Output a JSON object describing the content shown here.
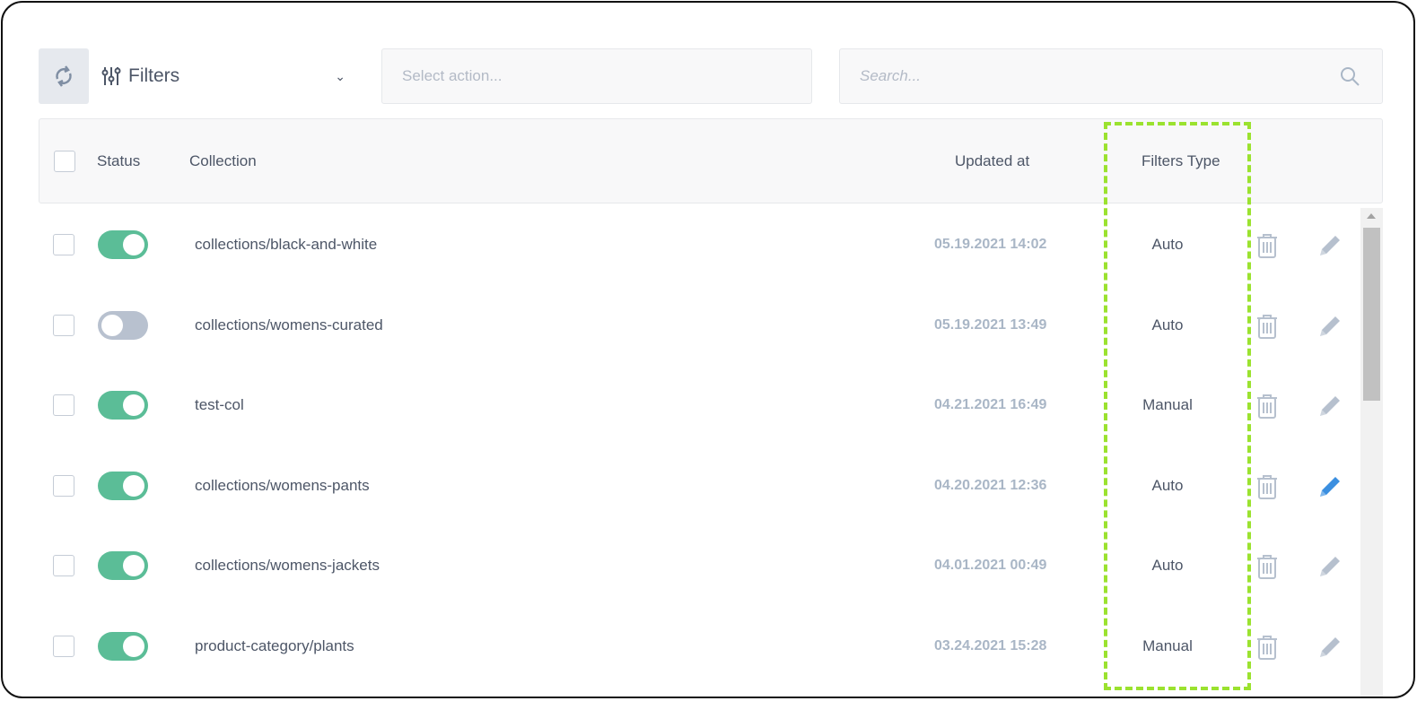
{
  "toolbar": {
    "filters_label": "Filters",
    "select_placeholder": "Select action...",
    "search_placeholder": "Search..."
  },
  "table": {
    "headers": {
      "status": "Status",
      "collection": "Collection",
      "updated": "Updated at",
      "filters_type": "Filters Type"
    },
    "rows": [
      {
        "enabled": true,
        "collection": "collections/black-and-white",
        "updated": "05.19.2021 14:02",
        "type": "Auto"
      },
      {
        "enabled": false,
        "collection": "collections/womens-curated",
        "updated": "05.19.2021 13:49",
        "type": "Auto"
      },
      {
        "enabled": true,
        "collection": "test-col",
        "updated": "04.21.2021 16:49",
        "type": "Manual"
      },
      {
        "enabled": true,
        "collection": "collections/womens-pants",
        "updated": "04.20.2021 12:36",
        "type": "Auto",
        "edit_active": true
      },
      {
        "enabled": true,
        "collection": "collections/womens-jackets",
        "updated": "04.01.2021 00:49",
        "type": "Auto"
      },
      {
        "enabled": true,
        "collection": "product-category/plants",
        "updated": "03.24.2021 15:28",
        "type": "Manual"
      }
    ]
  },
  "colors": {
    "toggle_on": "#5bbd97",
    "toggle_off": "#b8c1cf",
    "highlight": "#9be22f",
    "edit_active": "#3b8fe0",
    "icon": "#b6c0ce"
  }
}
